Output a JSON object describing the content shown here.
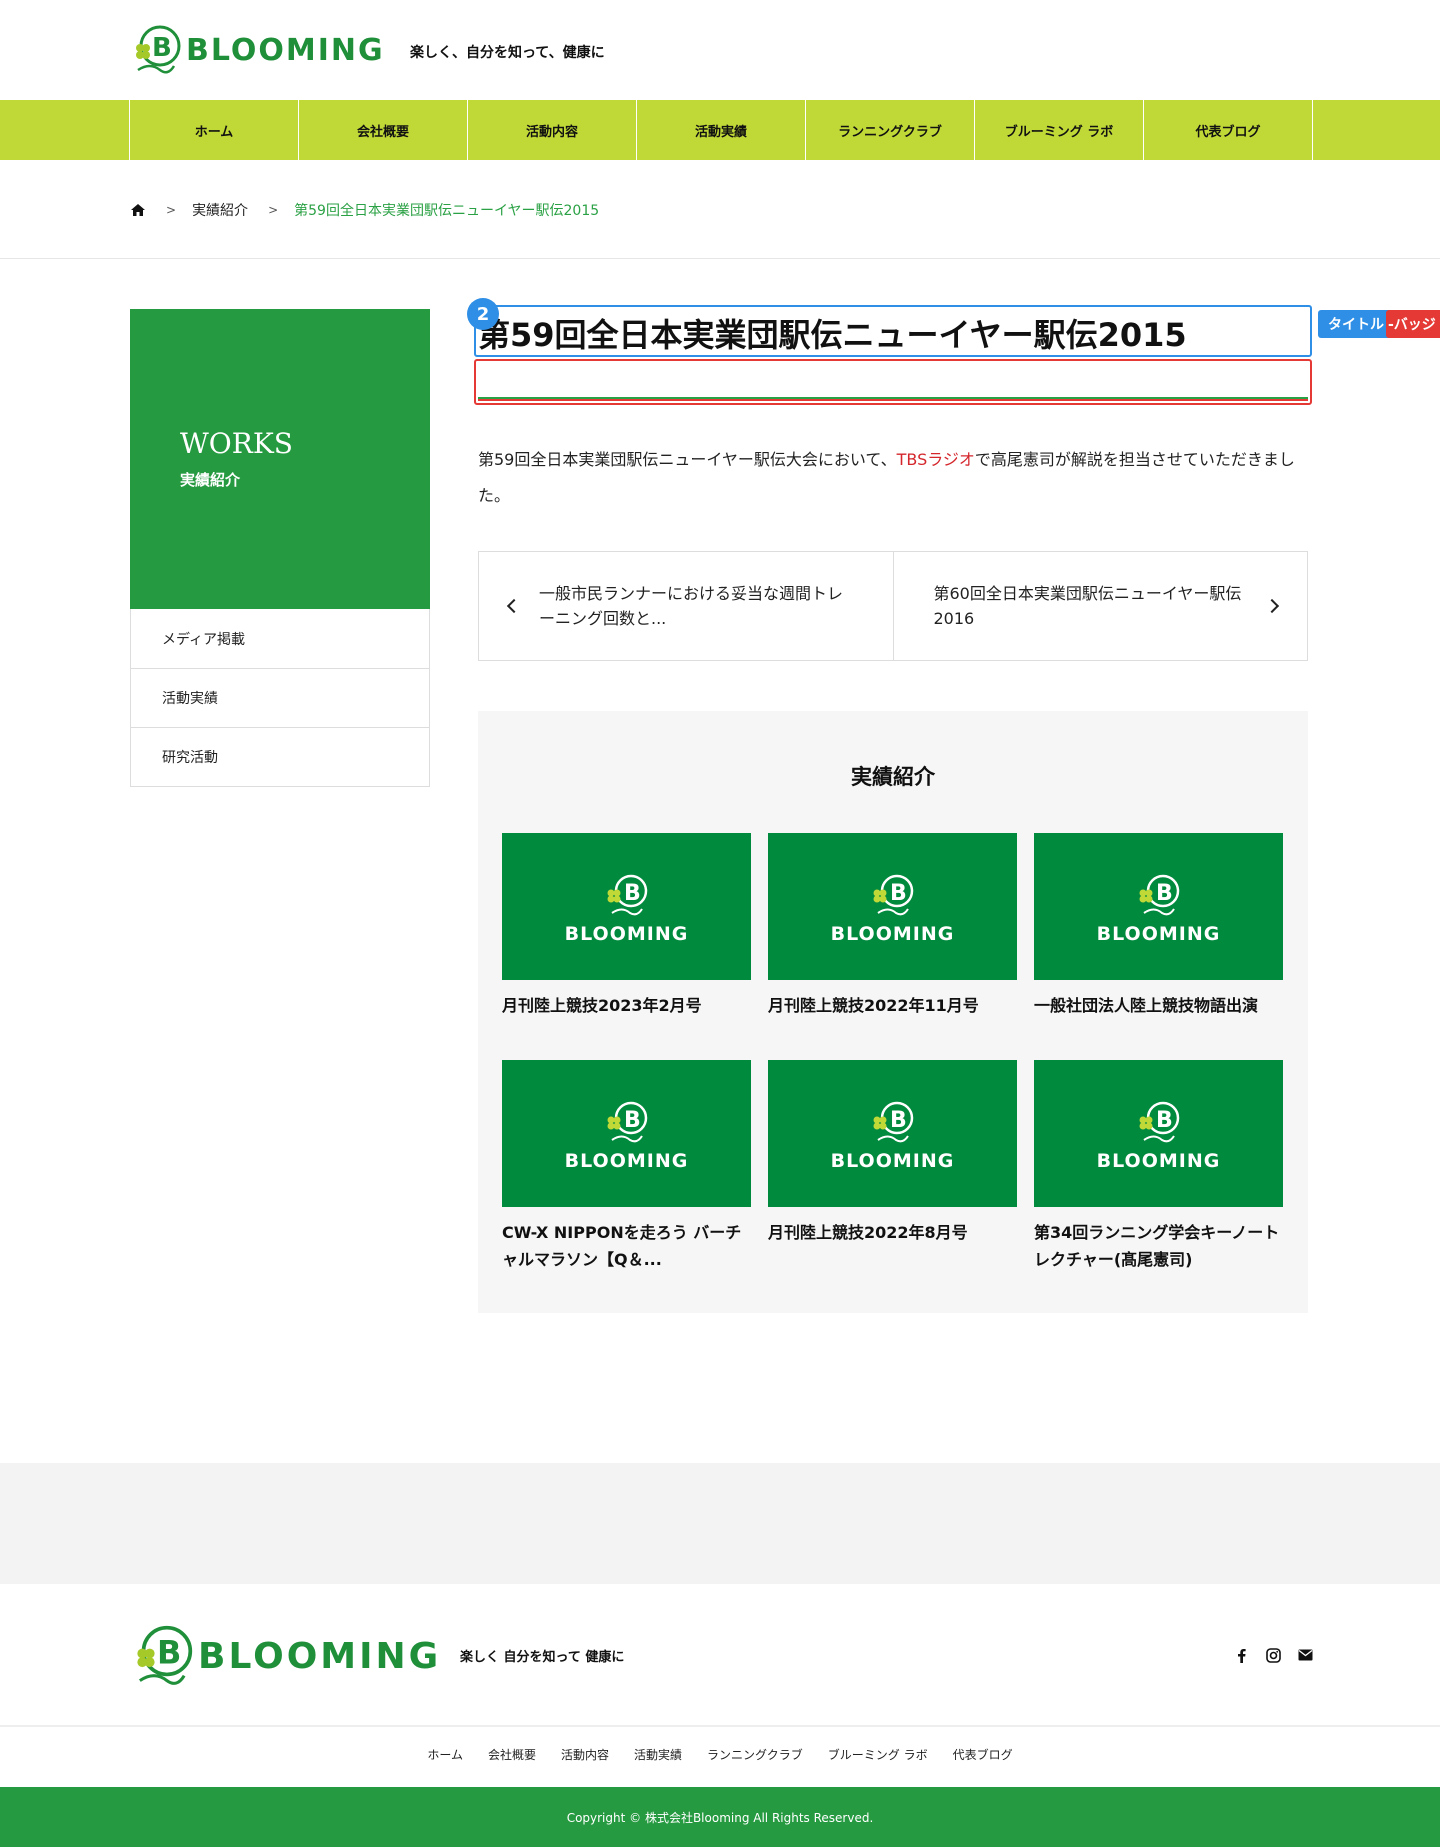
{
  "header": {
    "logo_text": "BLOOMING",
    "tagline": "楽しく、自分を知って、健康に"
  },
  "nav": [
    "ホーム",
    "会社概要",
    "活動内容",
    "活動実績",
    "ランニングクラブ",
    "ブルーミング ラボ",
    "代表ブログ"
  ],
  "breadcrumb": {
    "home_icon": "home-icon",
    "items": [
      "実績紹介",
      "第59回全日本実業団駅伝ニューイヤー駅伝2015"
    ]
  },
  "sidebar": {
    "title_en": "WORKS",
    "title_ja": "実績紹介",
    "items": [
      "メディア掲載",
      "活動実績",
      "研究活動"
    ]
  },
  "post": {
    "title": "第59回全日本実業団駅伝ニューイヤー駅伝2015",
    "body_before": "第59回全日本実業団駅伝ニューイヤー駅伝大会において、",
    "body_link": "TBSラジオ",
    "body_after": "で高尾憲司が解説を担当させていただきました。"
  },
  "overlay": {
    "number": "2",
    "title_tag": "タイトル",
    "badge_tag": "-バッジ"
  },
  "pager": {
    "prev": "一般市民ランナーにおける妥当な週間トレーニング回数と...",
    "next": "第60回全日本実業団駅伝ニューイヤー駅伝2016"
  },
  "related": {
    "heading": "実績紹介",
    "thumb_text": "BLOOMING",
    "cards": [
      "月刊陸上競技2023年2月号",
      "月刊陸上競技2022年11月号",
      "一般社団法人陸上競技物語出演",
      "CW-X NIPPONを走ろう バーチャルマラソン【Q＆...",
      "月刊陸上競技2022年8月号",
      "第34回ランニング学会キーノートレクチャー(髙尾憲司)"
    ]
  },
  "footer": {
    "logo_text": "BLOOMING",
    "tagline": "楽しく 自分を知って 健康に",
    "social": [
      "facebook-icon",
      "instagram-icon",
      "mail-icon"
    ],
    "nav": [
      "ホーム",
      "会社概要",
      "活動内容",
      "活動実績",
      "ランニングクラブ",
      "ブルーミング ラボ",
      "代表ブログ"
    ],
    "copyright": "Copyright © 株式会社Blooming All Rights Reserved."
  },
  "colors": {
    "brand_green": "#269a41",
    "nav_lime": "#c1d937",
    "link_red": "#d4272c",
    "overlay_blue": "#2f8fe6",
    "overlay_red": "#e53935"
  }
}
